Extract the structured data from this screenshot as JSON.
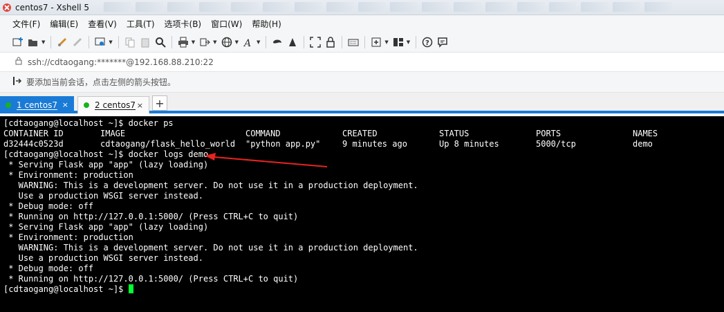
{
  "window": {
    "title": "centos7 - Xshell 5"
  },
  "menu": [
    "文件(F)",
    "编辑(E)",
    "查看(V)",
    "工具(T)",
    "选项卡(B)",
    "窗口(W)",
    "帮助(H)"
  ],
  "address": {
    "text": "ssh://cdtaogang:*******@192.168.88.210:22"
  },
  "hint": {
    "text": "要添加当前会话，点击左侧的箭头按钮。"
  },
  "tabs": [
    {
      "label": "1 centos7",
      "close": "×",
      "active": true
    },
    {
      "label": "2 centos7",
      "close": "×",
      "active": false
    }
  ],
  "tab_add": "+",
  "terminal": {
    "cmd1": "[cdtaogang@localhost ~]$ docker ps",
    "ps_headers": [
      "CONTAINER ID",
      "IMAGE",
      "COMMAND",
      "CREATED",
      "STATUS",
      "PORTS",
      "NAMES"
    ],
    "ps_row": [
      "d32444c0523d",
      "cdtaogang/flask_hello_world",
      "\"python app.py\"",
      "9 minutes ago",
      "Up 8 minutes",
      "5000/tcp",
      "demo"
    ],
    "cmd2": "[cdtaogang@localhost ~]$ docker logs demo",
    "log_lines": [
      " * Serving Flask app \"app\" (lazy loading)",
      " * Environment: production",
      "   WARNING: This is a development server. Do not use it in a production deployment.",
      "   Use a production WSGI server instead.",
      " * Debug mode: off",
      " * Running on http://127.0.0.1:5000/ (Press CTRL+C to quit)",
      " * Serving Flask app \"app\" (lazy loading)",
      " * Environment: production",
      "   WARNING: This is a development server. Do not use it in a production deployment.",
      "   Use a production WSGI server instead.",
      " * Debug mode: off",
      " * Running on http://127.0.0.1:5000/ (Press CTRL+C to quit)"
    ],
    "prompt": "[cdtaogang@localhost ~]$ "
  },
  "colors": {
    "tab_active": "#1a7bd6",
    "status_dot": "#17b31f",
    "cursor": "#00ff33",
    "annotation_arrow": "#e8231f"
  },
  "icons": [
    "new-session-icon",
    "open-folder-icon",
    "connect-icon",
    "disconnect-icon",
    "properties-icon",
    "copy-icon",
    "paste-icon",
    "find-icon",
    "print-icon",
    "transfer-icon",
    "globe-icon",
    "font-icon",
    "xftp-icon",
    "xmanager-icon",
    "fullscreen-icon",
    "lock-icon",
    "keyboard-icon",
    "add-tab-icon",
    "layout-icon",
    "help-icon",
    "chat-icon"
  ]
}
